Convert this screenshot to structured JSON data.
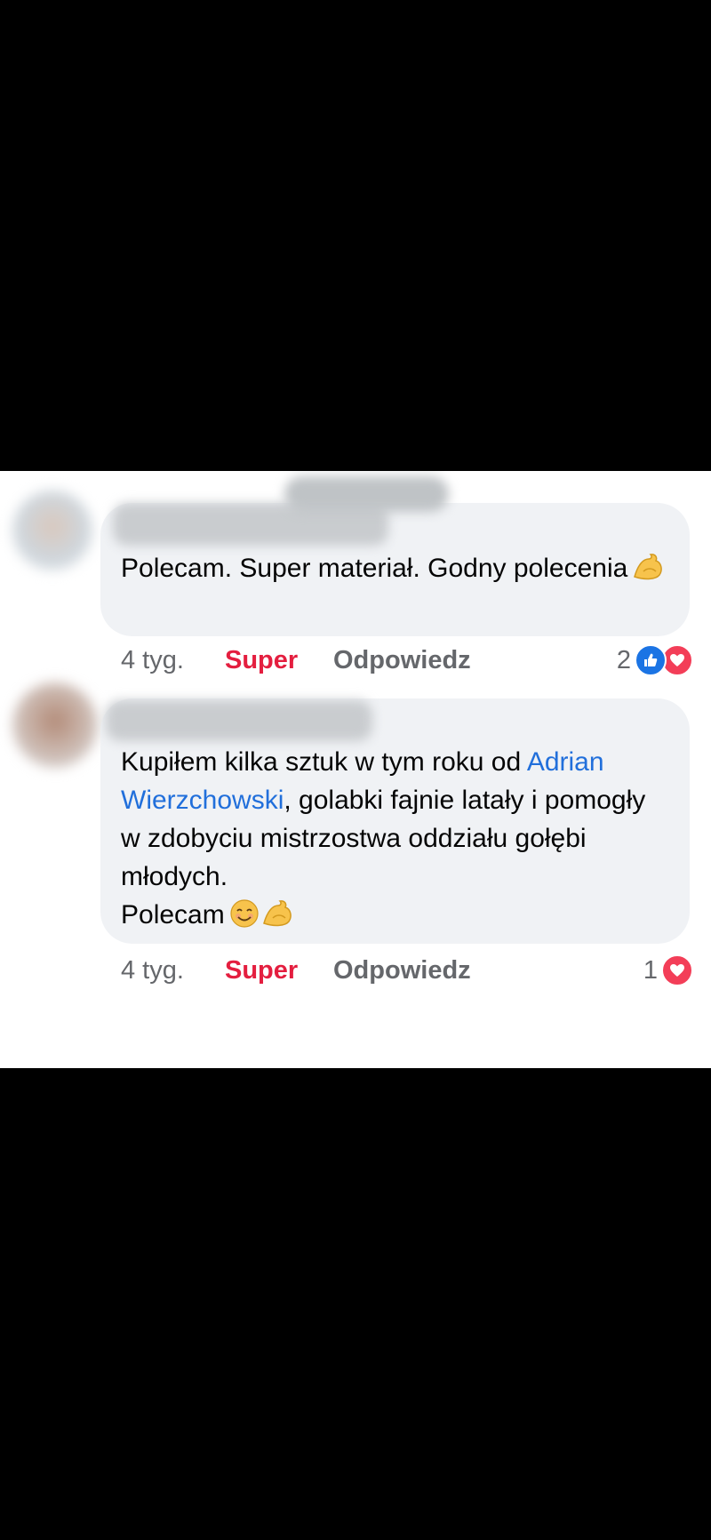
{
  "comments": [
    {
      "text": "Polecam. Super materiał. Godny polecenia",
      "emojis": [
        "flexed-biceps"
      ],
      "time": "4 tyg.",
      "reaction_label": "Super",
      "reply_label": "Odpowiedz",
      "reaction_count": "2",
      "reaction_types": [
        "like",
        "love"
      ]
    },
    {
      "text_before_mention": "Kupiłem kilka sztuk w tym roku od ",
      "mention": "Adrian Wierzchowski",
      "text_after_mention": ", golabki fajnie latały i pomogły w zdobyciu mistrzostwa oddziału gołębi młodych.",
      "text_last_line": "Polecam",
      "emojis": [
        "smiling-face",
        "flexed-biceps"
      ],
      "time": "4 tyg.",
      "reaction_label": "Super",
      "reply_label": "Odpowiedz",
      "reaction_count": "1",
      "reaction_types": [
        "love"
      ]
    }
  ],
  "colors": {
    "bubble_bg": "#f0f2f5",
    "text": "#050505",
    "muted": "#65676b",
    "super_red": "#e41e3f",
    "mention_blue": "#216fdb",
    "like_blue": "#1b74e4",
    "love_red": "#f33e58"
  }
}
